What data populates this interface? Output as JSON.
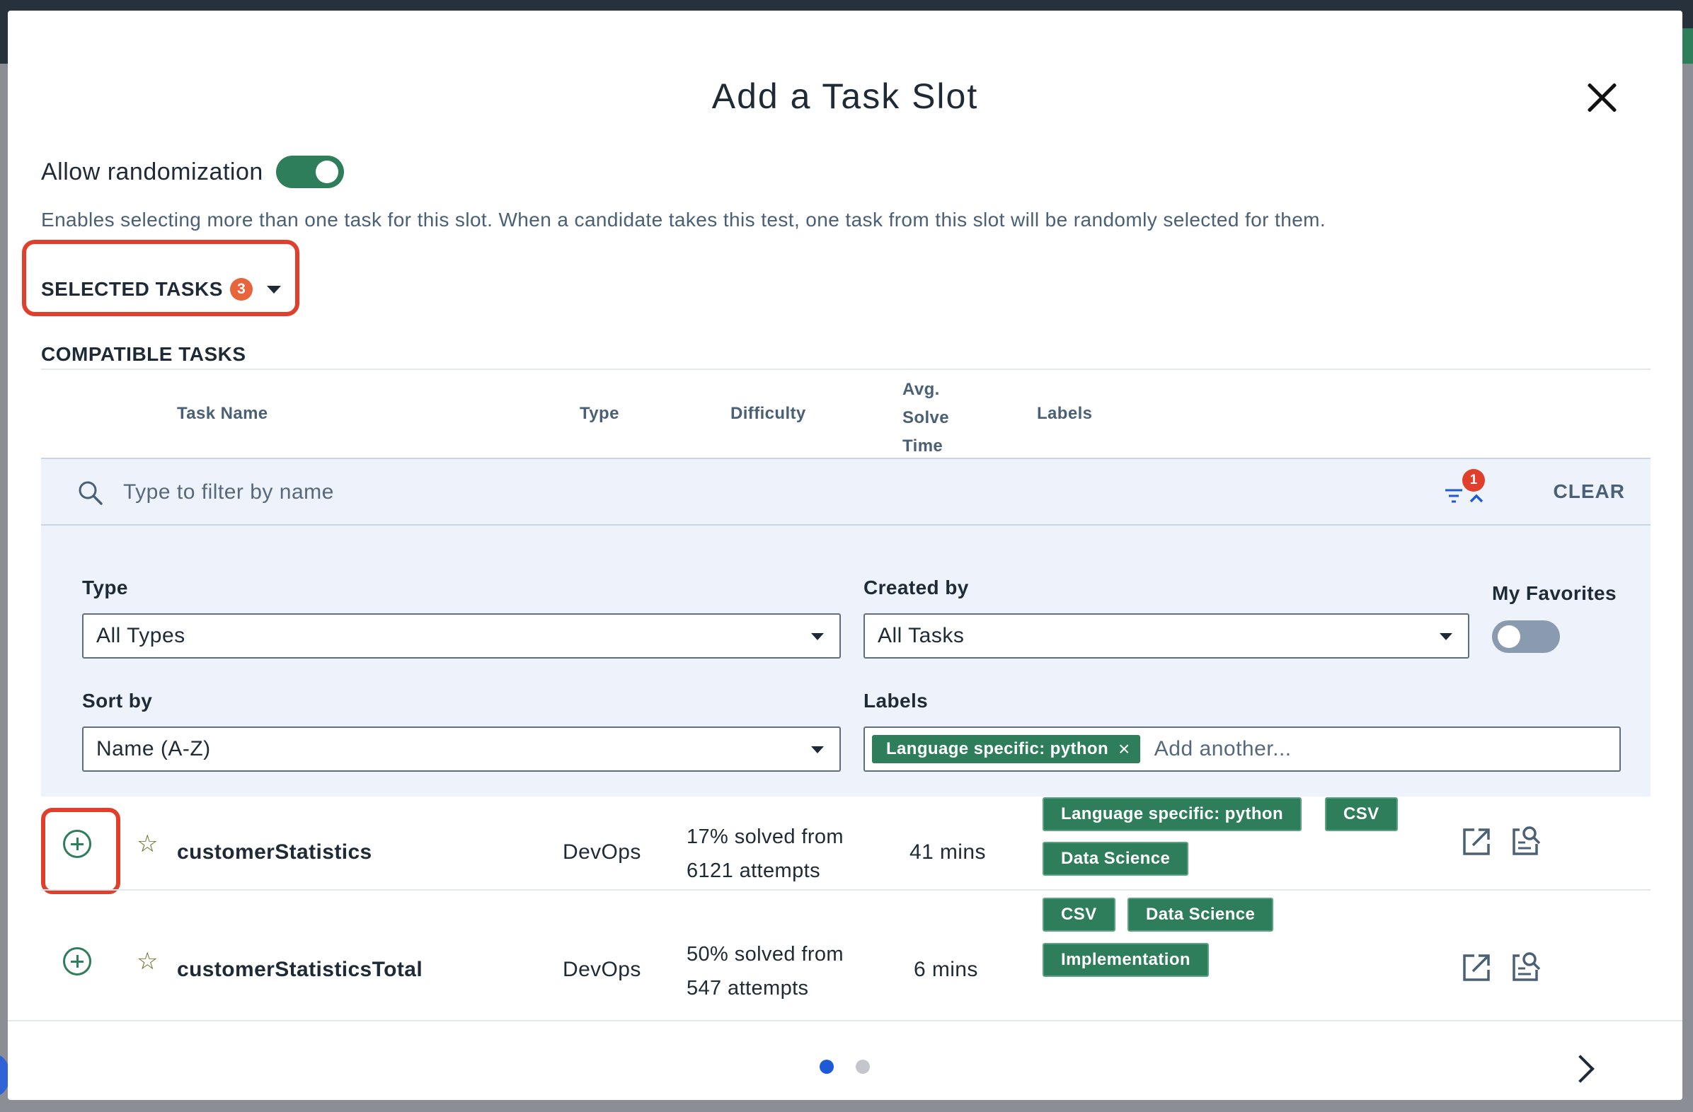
{
  "modal": {
    "title": "Add a Task Slot",
    "close_icon": "close-icon"
  },
  "randomization": {
    "label": "Allow randomization",
    "enabled": true,
    "description": "Enables selecting more than one task for this slot. When a candidate takes this test, one task from this slot will be randomly selected for them."
  },
  "selected_tasks": {
    "label": "SELECTED TASKS",
    "count": "3"
  },
  "compatible_tasks": {
    "label": "COMPATIBLE TASKS",
    "columns": {
      "task_name": "Task Name",
      "type": "Type",
      "difficulty": "Difficulty",
      "avg_line1": "Avg.",
      "avg_line2": "Solve",
      "avg_line3": "Time",
      "labels": "Labels"
    }
  },
  "filters": {
    "search_placeholder": "Type to filter by name",
    "active_filter_count": "1",
    "clear_label": "CLEAR",
    "type_label": "Type",
    "type_value": "All Types",
    "created_by_label": "Created by",
    "created_by_value": "All Tasks",
    "favorites_label": "My Favorites",
    "favorites_enabled": false,
    "sort_label": "Sort by",
    "sort_value": "Name (A-Z)",
    "labels_label": "Labels",
    "label_chip": "Language specific: python",
    "label_chip_remove": "×",
    "labels_placeholder": "Add another..."
  },
  "tasks": [
    {
      "name": "customerStatistics",
      "type": "DevOps",
      "difficulty_line1": "17% solved from",
      "difficulty_line2": "6121 attempts",
      "avg_time": "41 mins",
      "labels": [
        "Language specific: python",
        "CSV",
        "Data Science"
      ]
    },
    {
      "name": "customerStatisticsTotal",
      "type": "DevOps",
      "difficulty_line1": "50% solved from",
      "difficulty_line2": "547 attempts",
      "avg_time": "6 mins",
      "labels": [
        "CSV",
        "Data Science",
        "Implementation"
      ]
    }
  ],
  "pagination": {
    "pages": 2,
    "current": 1,
    "active_color": "#1e5ad6",
    "inactive_color": "#c3c7cc"
  },
  "colors": {
    "accent_green": "#2e7d5b",
    "highlight_red": "#e0402b",
    "badge_orange": "#e8643a"
  }
}
